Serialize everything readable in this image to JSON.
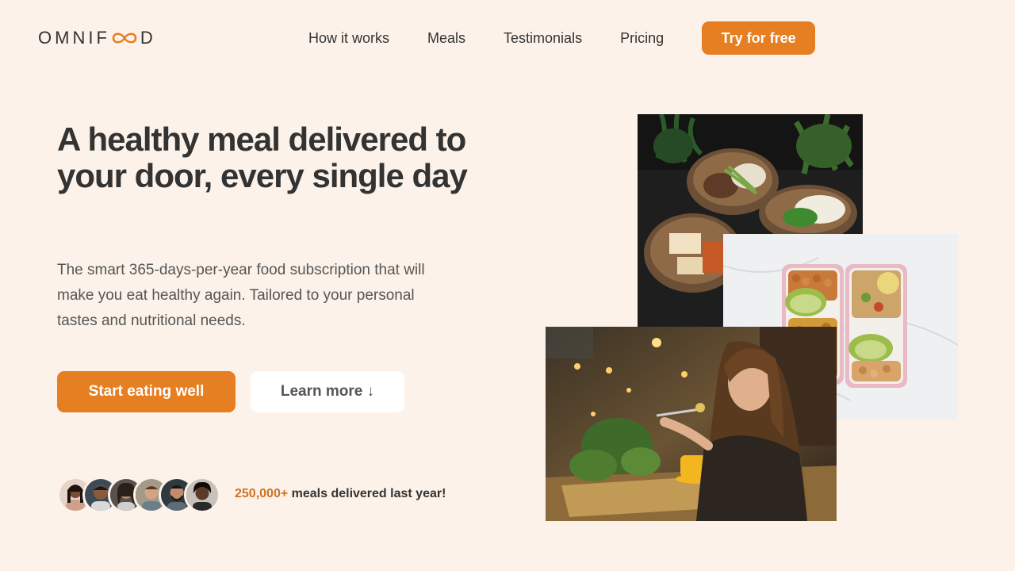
{
  "header": {
    "logo_text_left": "OMNIF",
    "logo_text_right": "D",
    "nav": [
      {
        "label": "How it works"
      },
      {
        "label": "Meals"
      },
      {
        "label": "Testimonials"
      },
      {
        "label": "Pricing"
      }
    ],
    "cta_label": "Try for free"
  },
  "hero": {
    "title": "A healthy meal delivered to your door, every single day",
    "description": "The smart 365-days-per-year food subscription that will make you eat healthy again. Tailored to your personal tastes and nutritional needs.",
    "primary_button": "Start eating well",
    "secondary_button": "Learn more ↓"
  },
  "delivered": {
    "count": "250,000+",
    "text": " meals delivered last year!",
    "avatar_count": 6
  },
  "colors": {
    "background": "#fdf2e9",
    "accent": "#e67e22",
    "accent_dark": "#cf711f",
    "text": "#333333"
  },
  "icons": {
    "logo_loop": "infinity-icon",
    "learn_more_arrow": "arrow-down-icon"
  }
}
